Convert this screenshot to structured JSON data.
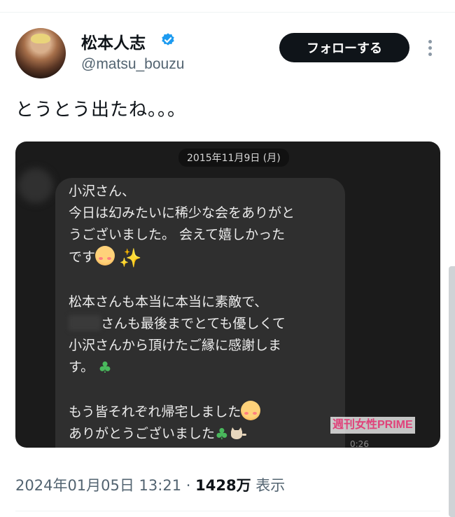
{
  "user": {
    "name": "松本人志",
    "handle": "@matsu_bouzu",
    "verified": true,
    "verified_color": "#1d9bf0"
  },
  "actions": {
    "follow_label": "フォローする",
    "more_icon": "more-vertical-icon"
  },
  "tweet": {
    "text": "とうとう出たね。。。"
  },
  "media": {
    "date_label": "2015年11月9日 (月)",
    "message": {
      "l1": "小沢さん、",
      "l2": "今日は幻みたいに稀少な会をありがと",
      "l3": "うございました。 会えて嬉しかった",
      "l4": "です",
      "l5": "松本さんも本当に本当に素敵で、",
      "l6": "さんも最後までとても優しくて",
      "l7": "小沢さんから頂けたご縁に感謝しま",
      "l8": "す。",
      "l9": "もう皆それぞれ帰宅しました",
      "l10": "ありがとうございました"
    },
    "watermark": "週刊女性PRIME",
    "duration": "0:26"
  },
  "meta": {
    "timestamp": "2024年01月05日 13:21",
    "separator": "·",
    "views_count": "1428万",
    "views_label": "表示"
  }
}
